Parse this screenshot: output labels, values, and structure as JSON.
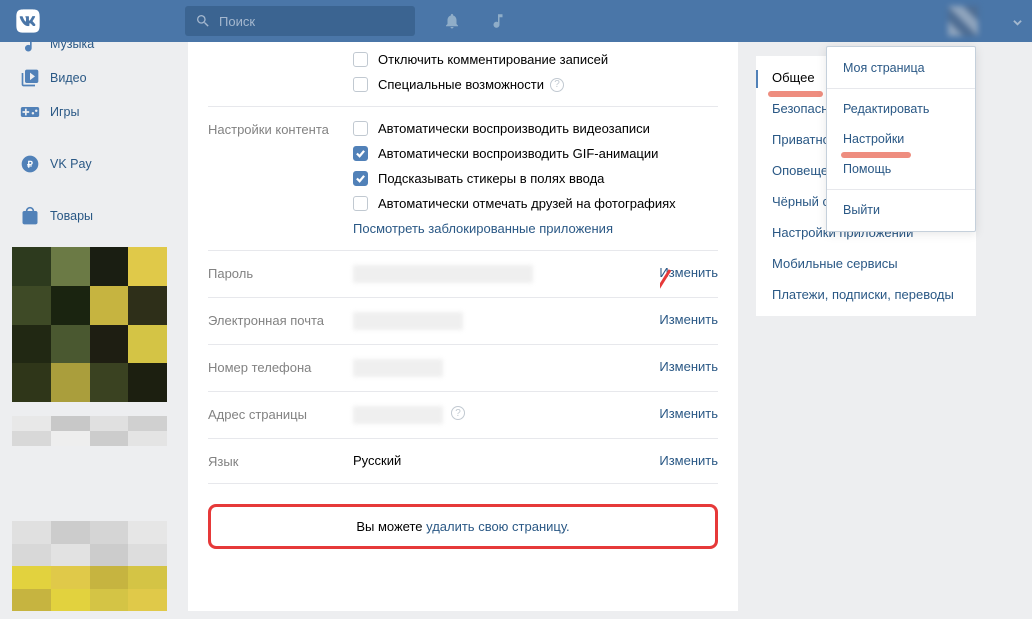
{
  "header": {
    "search_placeholder": "Поиск"
  },
  "nav": {
    "music": "Музыка",
    "video": "Видео",
    "games": "Игры",
    "vkpay": "VK Pay",
    "market": "Товары"
  },
  "general": {
    "disable_comments": "Отключить комментирование записей",
    "accessibility": "Специальные возможности"
  },
  "content": {
    "label": "Настройки контента",
    "auto_video": "Автоматически воспроизводить видеозаписи",
    "auto_gif": "Автоматически воспроизводить GIF-анимации",
    "stickers": "Подсказывать стикеры в полях ввода",
    "auto_tag": "Автоматически отмечать друзей на фотографиях",
    "blocked_apps": "Посмотреть заблокированные приложения"
  },
  "rows": {
    "password_label": "Пароль",
    "email_label": "Электронная почта",
    "phone_label": "Номер телефона",
    "address_label": "Адрес страницы",
    "language_label": "Язык",
    "language_value": "Русский",
    "change": "Изменить"
  },
  "delete": {
    "prefix": "Вы можете ",
    "link": "удалить свою страницу."
  },
  "tabs": {
    "general": "Общее",
    "security": "Безопасность",
    "privacy": "Приватность",
    "notifications": "Оповещения",
    "blacklist": "Чёрный список",
    "apps": "Настройки приложений",
    "mobile": "Мобильные сервисы",
    "payments": "Платежи, подписки, переводы"
  },
  "dropdown": {
    "my_page": "Моя страница",
    "edit": "Редактировать",
    "settings": "Настройки",
    "help": "Помощь",
    "logout": "Выйти"
  }
}
